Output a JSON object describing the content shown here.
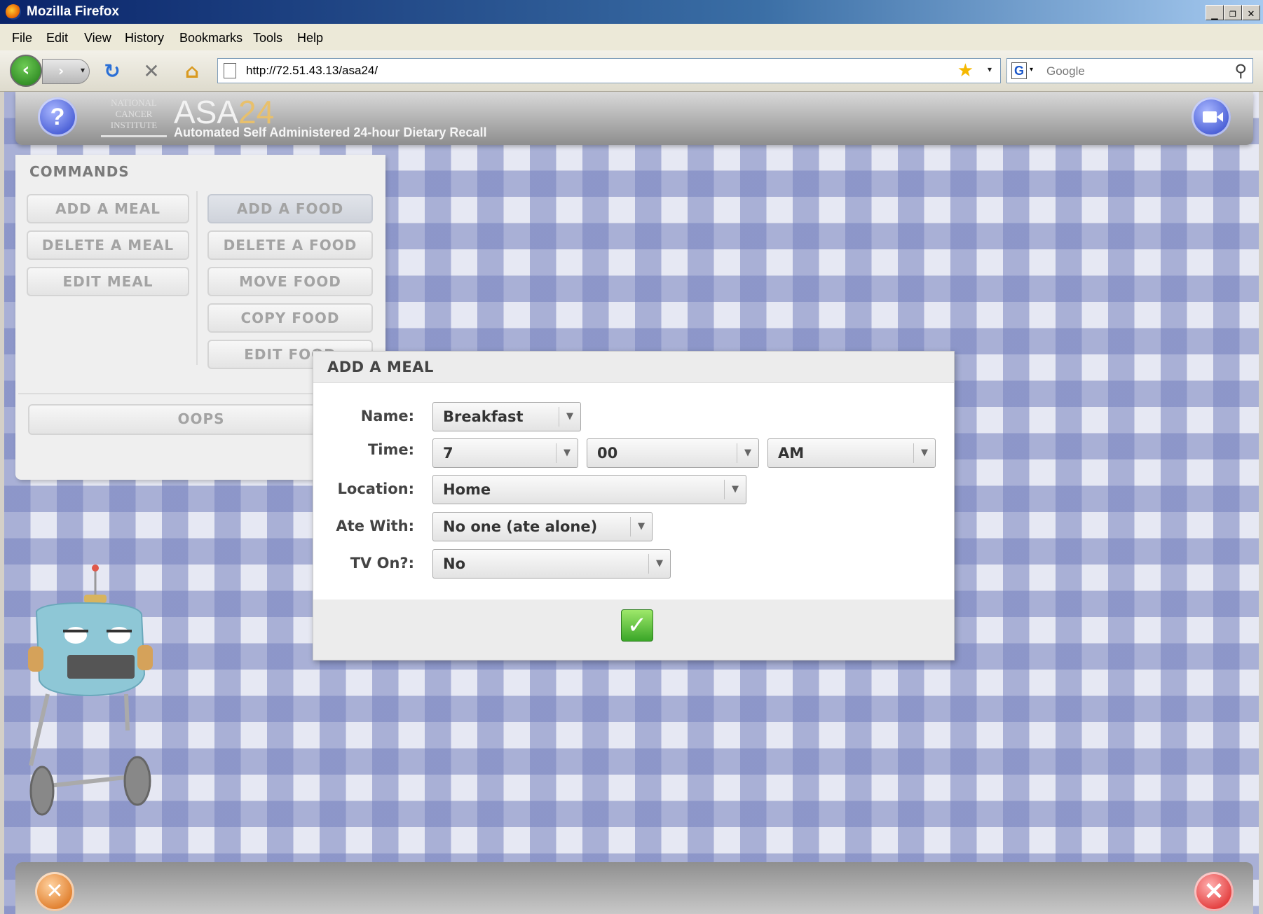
{
  "window": {
    "title": "Mozilla Firefox",
    "minimize_label": "_",
    "restore_label": "❐",
    "close_label": "✕"
  },
  "menubar": [
    "File",
    "Edit",
    "View",
    "History",
    "Bookmarks",
    "Tools",
    "Help"
  ],
  "toolbar": {
    "url": "http://72.51.43.13/asa24/",
    "search_placeholder": "Google",
    "search_engine_letter": "G"
  },
  "app": {
    "logo_text": "NATIONAL CANCER INSTITUTE",
    "title_main": "ASA",
    "title_num": "24",
    "subtitle": "Automated Self Administered 24-hour Dietary Recall",
    "help_label": "?"
  },
  "commands": {
    "heading": "COMMANDS",
    "meal_buttons": [
      "ADD A MEAL",
      "DELETE A MEAL",
      "EDIT MEAL"
    ],
    "food_buttons": [
      "ADD A FOOD",
      "DELETE A FOOD",
      "MOVE FOOD",
      "COPY FOOD",
      "EDIT FOOD"
    ],
    "oops": "OOPS"
  },
  "dialog": {
    "title": "ADD A MEAL",
    "fields": {
      "name": {
        "label": "Name:",
        "value": "Breakfast"
      },
      "time": {
        "label": "Time:",
        "hour": "7",
        "minute": "00",
        "ampm": "AM"
      },
      "location": {
        "label": "Location:",
        "value": "Home"
      },
      "ate_with": {
        "label": "Ate With:",
        "value": "No one (ate alone)"
      },
      "tv_on": {
        "label": "TV On?:",
        "value": "No"
      }
    },
    "ok_icon": "checkmark-icon"
  },
  "colors": {
    "checker_blue": "#7682be",
    "header_gray": "#8e8e8e",
    "confirm_green": "#3aa628",
    "close_red": "#e33c3c"
  }
}
